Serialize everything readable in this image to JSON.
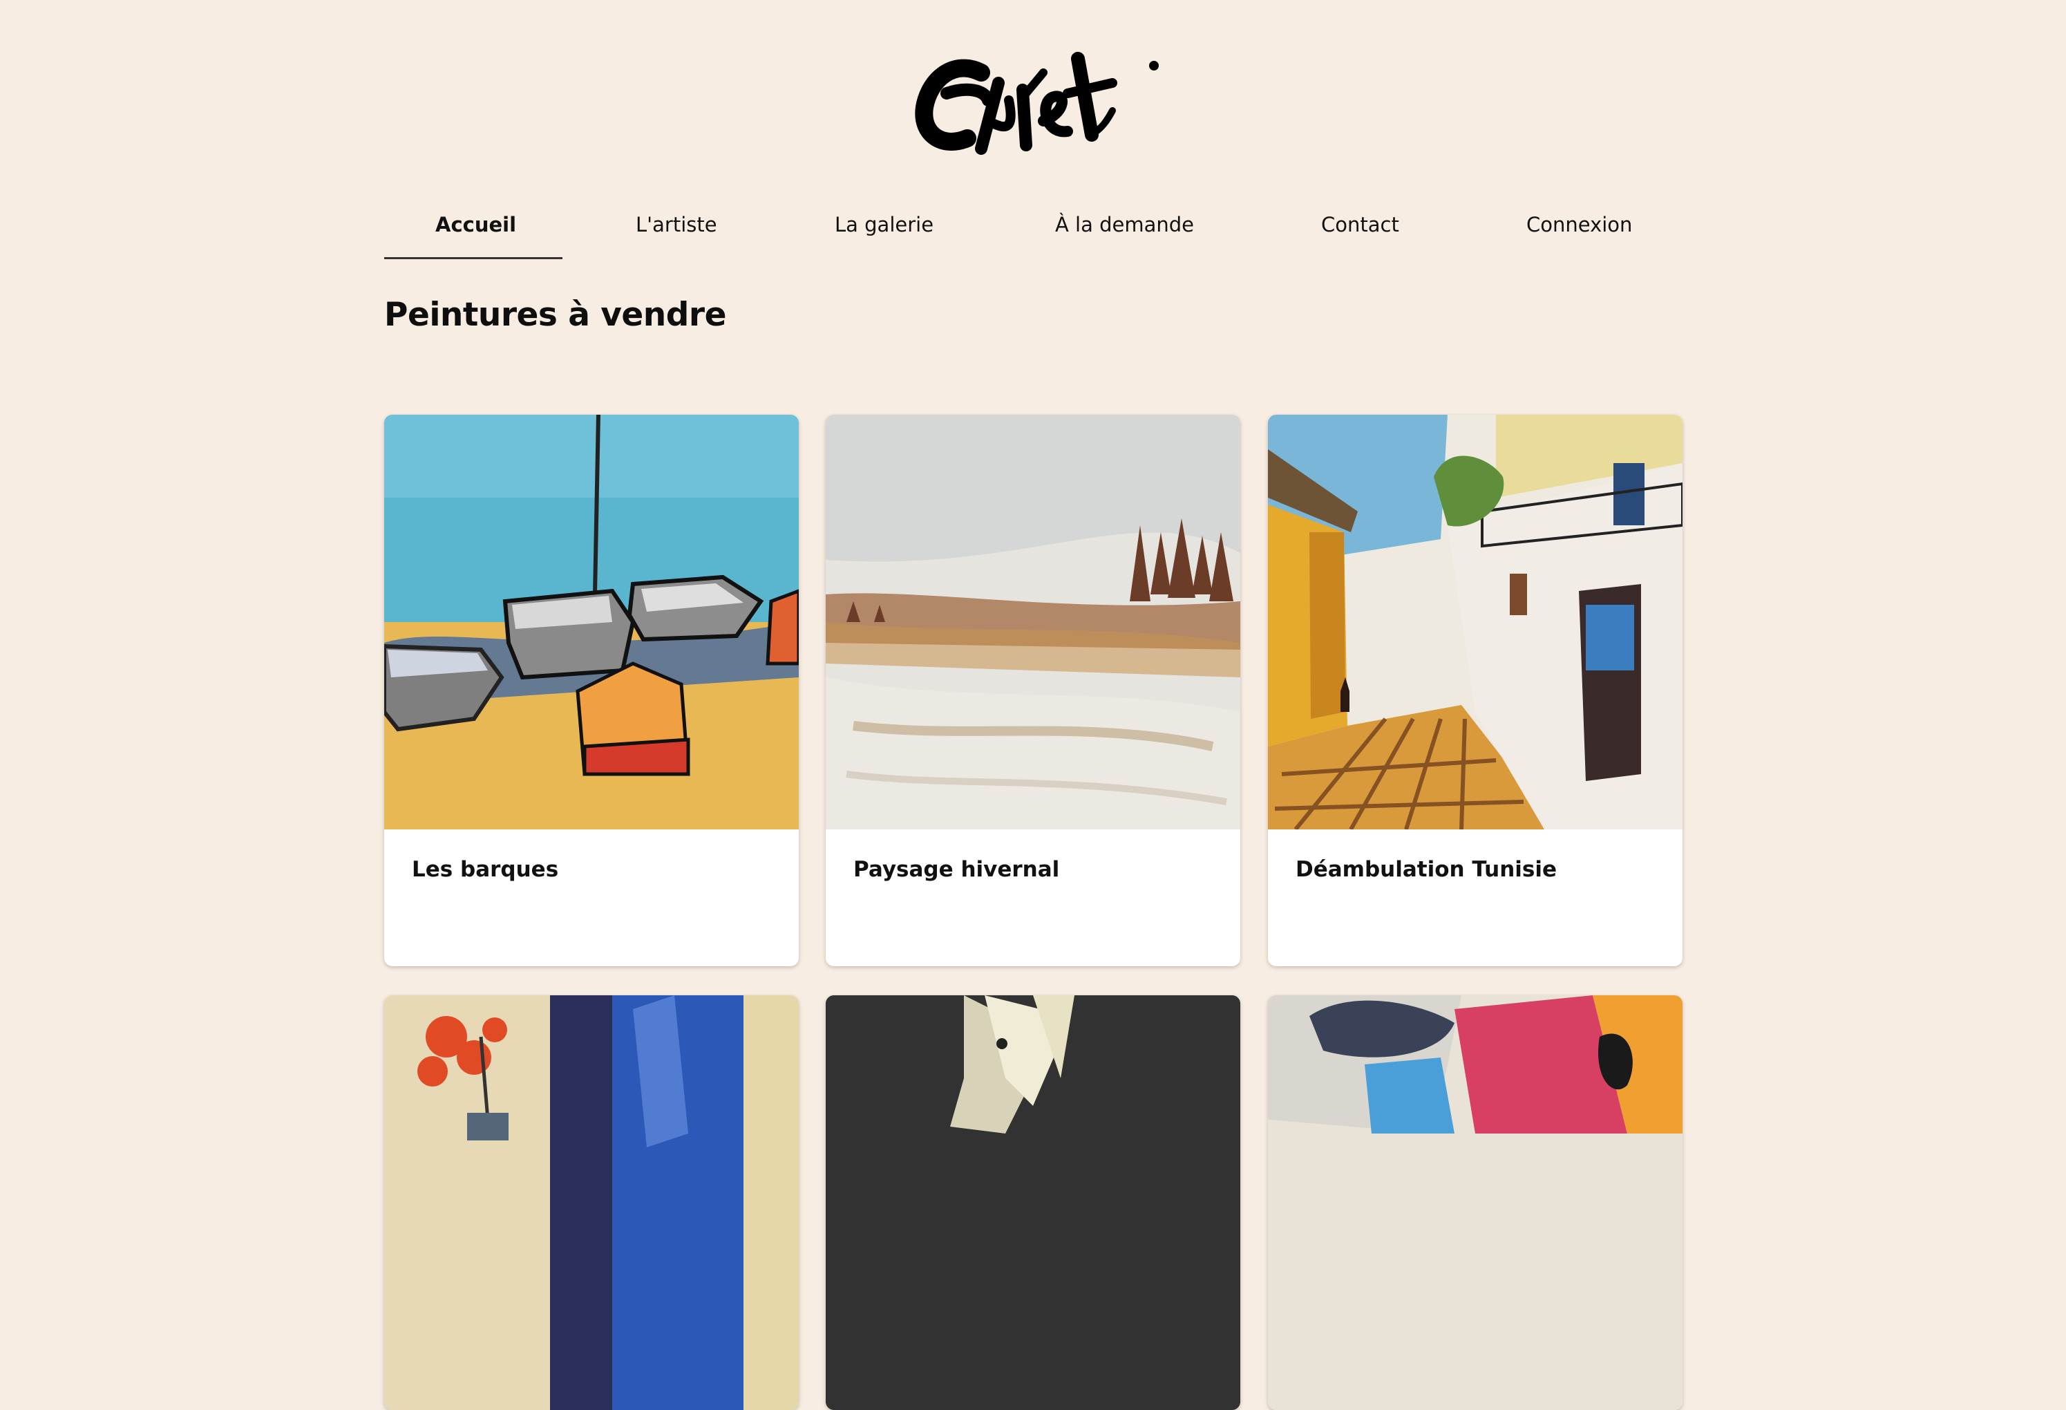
{
  "header": {
    "logo_icon": "signature-logo-icon"
  },
  "nav": {
    "items": [
      {
        "label": "Accueil",
        "active": true
      },
      {
        "label": "L'artiste",
        "active": false
      },
      {
        "label": "La galerie",
        "active": false
      },
      {
        "label": "À la demande",
        "active": false
      },
      {
        "label": "Contact",
        "active": false
      },
      {
        "label": "Connexion",
        "active": false
      }
    ]
  },
  "main": {
    "title": "Peintures à vendre",
    "paintings": [
      {
        "title": "Les barques"
      },
      {
        "title": "Paysage hivernal"
      },
      {
        "title": "Déambulation Tunisie"
      },
      {
        "title": ""
      },
      {
        "title": ""
      },
      {
        "title": ""
      }
    ]
  },
  "colors": {
    "background": "#f8ede2",
    "card": "#ffffff",
    "text": "#111111"
  }
}
